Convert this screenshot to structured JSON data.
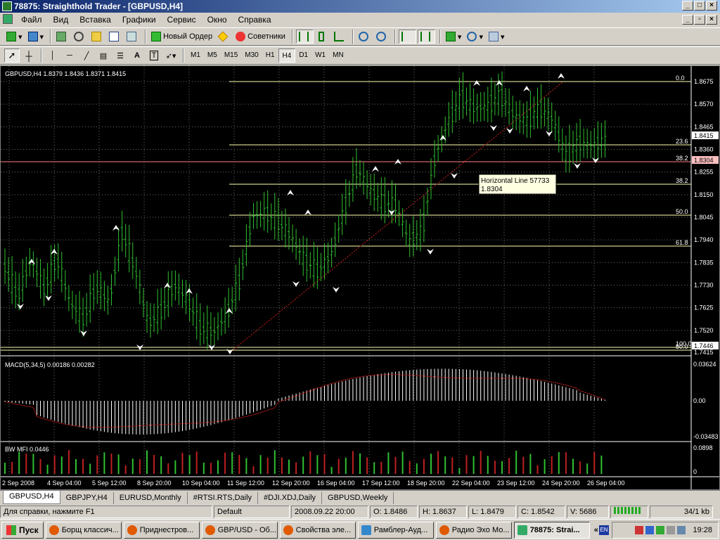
{
  "window": {
    "title": "78875: Straighthold Trader - [GBPUSD,H4]"
  },
  "menu": [
    "Файл",
    "Вид",
    "Вставка",
    "Графики",
    "Сервис",
    "Окно",
    "Справка"
  ],
  "toolbar": {
    "new_order": "Новый Ордер",
    "experts": "Советники"
  },
  "toolbar2": {
    "text_tool": "A",
    "text_label_tool": "T"
  },
  "timeframes": [
    {
      "label": "M1"
    },
    {
      "label": "M5"
    },
    {
      "label": "M15"
    },
    {
      "label": "M30"
    },
    {
      "label": "H1"
    },
    {
      "label": "H4",
      "active": true
    },
    {
      "label": "D1"
    },
    {
      "label": "W1"
    },
    {
      "label": "MN"
    }
  ],
  "chart": {
    "header": "GBPUSD,H4  1.8379 1.8436 1.8371 1.8415",
    "price_labels": [
      "1.8675",
      "1.8570",
      "1.8465",
      "1.8415",
      "1.8360",
      "1.8304",
      "1.8255",
      "1.8150",
      "1.8045",
      "1.7940",
      "1.7835",
      "1.7730",
      "1.7625",
      "1.7520",
      "1.7446",
      "1.7415"
    ],
    "fib_levels": [
      "0.0",
      "23.6",
      "38.2",
      "38.2",
      "50.0",
      "61.8",
      "100.0",
      "50.0"
    ],
    "tooltip": {
      "title": "Horizontal Line 57733",
      "value": "1.8304"
    },
    "macd": {
      "header": "MACD(5,34,5) 0.00186 0.00282",
      "ticks": [
        "0.03624",
        "0.00",
        "-0.03483"
      ]
    },
    "mfi": {
      "header": "BW MFI 0.0446",
      "ticks": [
        "0.0898",
        "0"
      ]
    },
    "dates": [
      "2 Sep 2008",
      "4 Sep 04:00",
      "5 Sep 12:00",
      "8 Sep 20:00",
      "10 Sep 04:00",
      "11 Sep 12:00",
      "12 Sep 20:00",
      "16 Sep 04:00",
      "17 Sep 12:00",
      "18 Sep 20:00",
      "22 Sep 04:00",
      "23 Sep 12:00",
      "24 Sep 20:00",
      "26 Sep 04:00"
    ],
    "colors": {
      "bull": "#30c030",
      "grid": "#b0b0b0",
      "fib": "#ffffb0",
      "hline": "#ff8080",
      "trend": "#d02020"
    }
  },
  "chart_data": {
    "type": "candlestick",
    "symbol": "GBPUSD",
    "timeframe": "H4",
    "ohlc_last": {
      "open": 1.8379,
      "high": 1.8436,
      "low": 1.8371,
      "close": 1.8415
    },
    "ylim": [
      1.7415,
      1.8675
    ],
    "horizontal_line": 1.8304
  },
  "tabs": [
    {
      "label": "GBPUSD,H4",
      "active": true
    },
    {
      "label": "GBPJPY,H4"
    },
    {
      "label": "EURUSD,Monthly"
    },
    {
      "label": "#RTSI.RTS,Daily"
    },
    {
      "label": "#DJI.XDJ,Daily"
    },
    {
      "label": "GBPUSD,Weekly"
    }
  ],
  "status": {
    "help": "Для справки, нажмите F1",
    "profile": "Default",
    "datetime": "2008.09.22 20:00",
    "open": "O: 1.8486",
    "high": "H: 1.8637",
    "low": "L: 1.8479",
    "close": "C: 1.8542",
    "volume": "V: 5686",
    "traffic": "34/1 kb"
  },
  "taskbar": {
    "start": "Пуск",
    "items": [
      {
        "label": "Борщ классич..."
      },
      {
        "label": "Приднестров..."
      },
      {
        "label": "GBP/USD - Об..."
      },
      {
        "label": "Свойства эле..."
      },
      {
        "label": "Рамблер-Ауд..."
      },
      {
        "label": "Радио Эхо Мо..."
      },
      {
        "label": "78875: Strai...",
        "active": true
      }
    ],
    "lang": "EN",
    "clock": "19:28"
  }
}
